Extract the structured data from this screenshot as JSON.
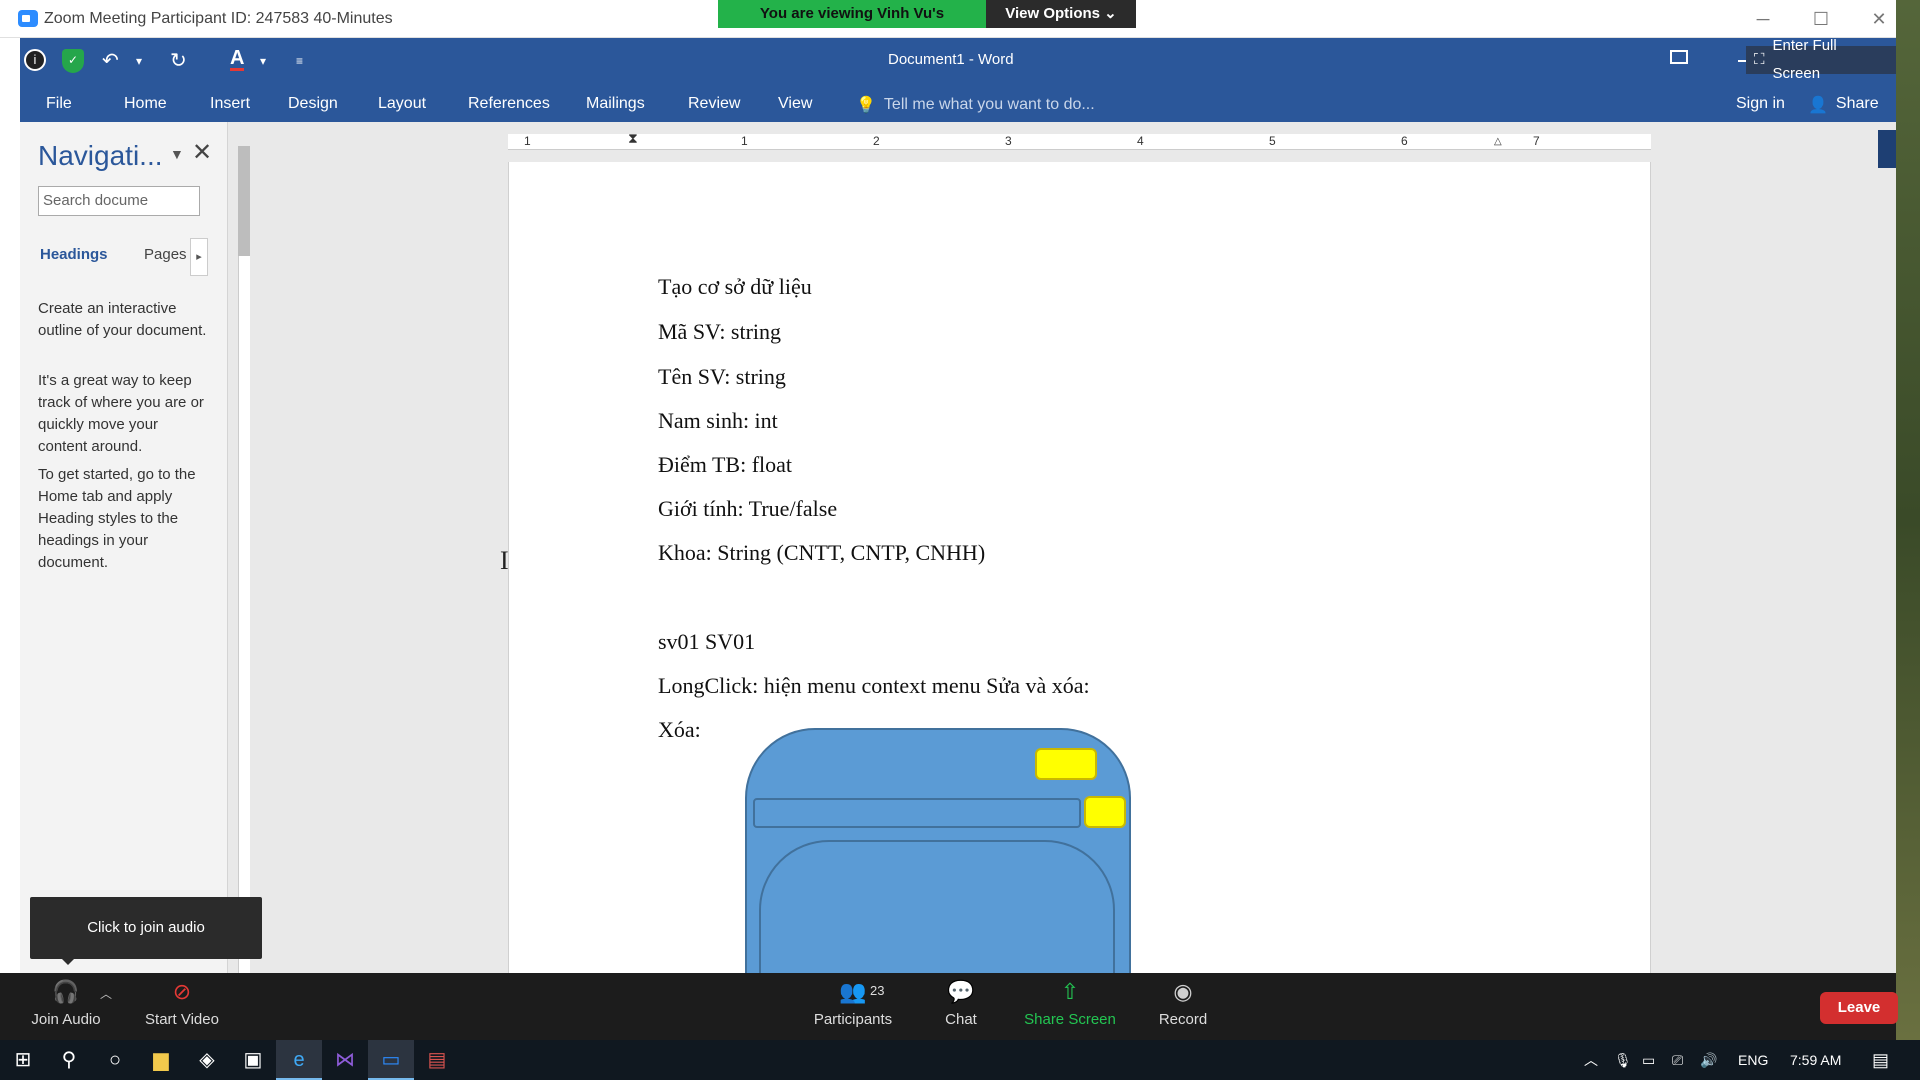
{
  "zoom": {
    "window_title": "Zoom Meeting Participant ID: 247583   40-Minutes",
    "banner_text": "You are viewing Vinh Vu's screen",
    "view_options": "View Options ⌄",
    "fullscreen_label": "Enter Full Screen",
    "tooltip": "Click to join audio",
    "toolbar": {
      "join_audio": "Join Audio",
      "start_video": "Start Video",
      "participants": "Participants",
      "participant_count": "23",
      "chat": "Chat",
      "share_screen": "Share Screen",
      "record": "Record",
      "leave": "Leave"
    }
  },
  "word": {
    "doc_title": "Document1 - Word",
    "tabs": [
      "File",
      "Home",
      "Insert",
      "Design",
      "Layout",
      "References",
      "Mailings",
      "Review",
      "View"
    ],
    "tell_me": "Tell me what you want to do...",
    "sign_in": "Sign in",
    "share": "Share",
    "nav": {
      "title": "Navigati...",
      "search_placeholder": "Search docume",
      "tab_headings": "Headings",
      "tab_pages": "Pages",
      "para1": "Create an interactive outline of your document.",
      "para2": "It's a great way to keep track of where you are or quickly move your content around.",
      "para3": "To get started, go to the Home tab and apply Heading styles to the headings in your document."
    },
    "ruler_numbers": [
      "1",
      "1",
      "2",
      "3",
      "4",
      "5",
      "6",
      "7"
    ],
    "lines": [
      "Tạo cơ sở dữ liệu",
      "Mã SV: string",
      "Tên SV: string",
      "Nam sinh: int",
      "Điểm TB: float",
      "Giới tính: True/false",
      "Khoa: String (CNTT, CNTP, CNHH)",
      "sv01 SV01",
      "LongClick: hiện menu context menu Sửa và xóa:",
      "Xóa:"
    ]
  },
  "taskbar": {
    "lang": "ENG",
    "time": "7:59 AM"
  },
  "colors": {
    "word_blue": "#2b579a",
    "zoom_green": "#23b24a",
    "leave_red": "#d32f2f",
    "shape_blue": "#5b9bd5",
    "shape_yellow": "#ffff00"
  }
}
